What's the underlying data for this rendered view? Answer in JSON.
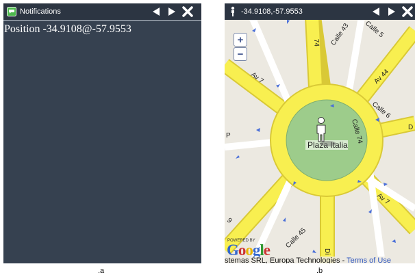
{
  "panel_a": {
    "title": "Notifications",
    "icon": "chat-bubble-icon",
    "message": "Position -34.9108@-57.9553"
  },
  "panel_b": {
    "title": "-34.9108,-57.9553",
    "icon": "person-icon",
    "map": {
      "plaza_label": "Plaza Italia",
      "street_labels": [
        "74",
        "Calle 43",
        "Calle 5",
        "Av 7",
        "Av 44",
        "Calle 6",
        "Calle 74",
        "Av 7",
        "Calle 45",
        "Di",
        "9",
        "P",
        "D"
      ],
      "zoom_in": "+",
      "zoom_out": "−",
      "powered_by": "POWERED BY",
      "logo": "Google",
      "attribution": "stemas SRL, Europa Technologies - ",
      "terms_link": "Terms of Use"
    }
  },
  "nav_icons": [
    "back-arrow-icon",
    "forward-arrow-icon",
    "close-icon"
  ],
  "captions": {
    "a": ".a",
    "b": ".b"
  },
  "colors": {
    "panel_bg": "#364150",
    "titlebar_bg": "#2c3542",
    "road": "#f8ef50",
    "road_edge": "#d9c936",
    "plaza_green": "#9dcc8b",
    "map_bg": "#ece9e1",
    "link": "#2a52be"
  }
}
